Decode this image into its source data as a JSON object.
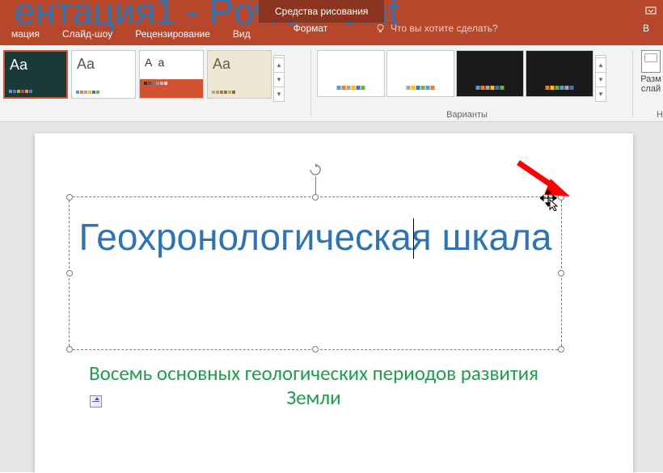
{
  "window": {
    "title": "ентация1 - PowerPoint",
    "drawing_tools": "Средства рисования"
  },
  "tabs": {
    "animations": "мация",
    "slideshow": "Слайд-шоу",
    "review": "Рецензирование",
    "view": "Вид",
    "format": "Формат",
    "tellme_placeholder": "Что вы хотите сделать?",
    "right": "В"
  },
  "ribbon": {
    "variants_label": "Варианты",
    "size_label_1": "Разм",
    "size_label_2": "слай",
    "box_label": "Н",
    "theme_aa": "Aa",
    "theme_aa_spaced": "A a"
  },
  "slide": {
    "title": "Геохронологическая шкала",
    "subtitle": "Восемь основных геологических периодов развития Земли"
  }
}
